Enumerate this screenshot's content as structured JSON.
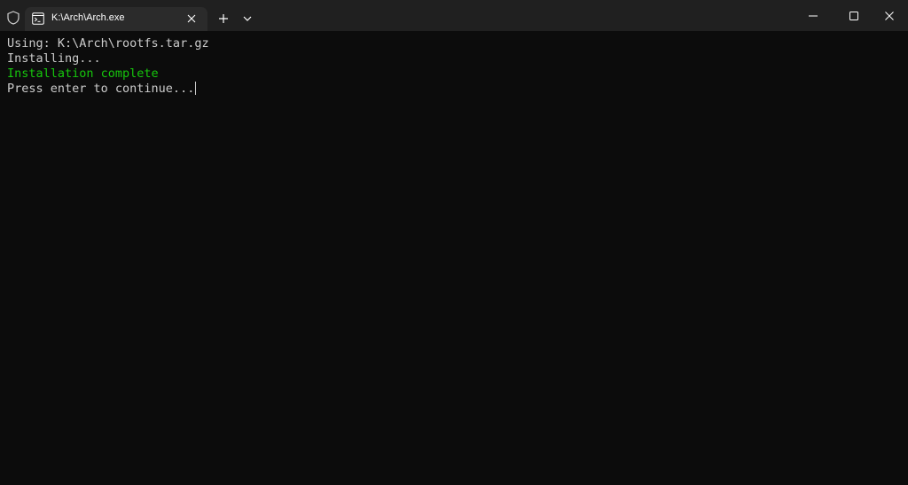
{
  "window": {
    "tab_title": "K:\\Arch\\Arch.exe",
    "icons": [
      "shield-icon",
      "terminal-icon",
      "close-icon",
      "plus-icon",
      "chevron-down-icon",
      "minimize-icon",
      "maximize-icon",
      "window-close-icon"
    ]
  },
  "terminal": {
    "lines": {
      "0": "Using: K:\\Arch\\rootfs.tar.gz",
      "1": "Installing...",
      "2": "Installation complete",
      "3": "Press enter to continue..."
    }
  },
  "colors": {
    "background": "#0c0c0c",
    "titlebar": "#202020",
    "tab": "#2b2b2b",
    "text": "#cccccc",
    "success": "#16c60c"
  }
}
